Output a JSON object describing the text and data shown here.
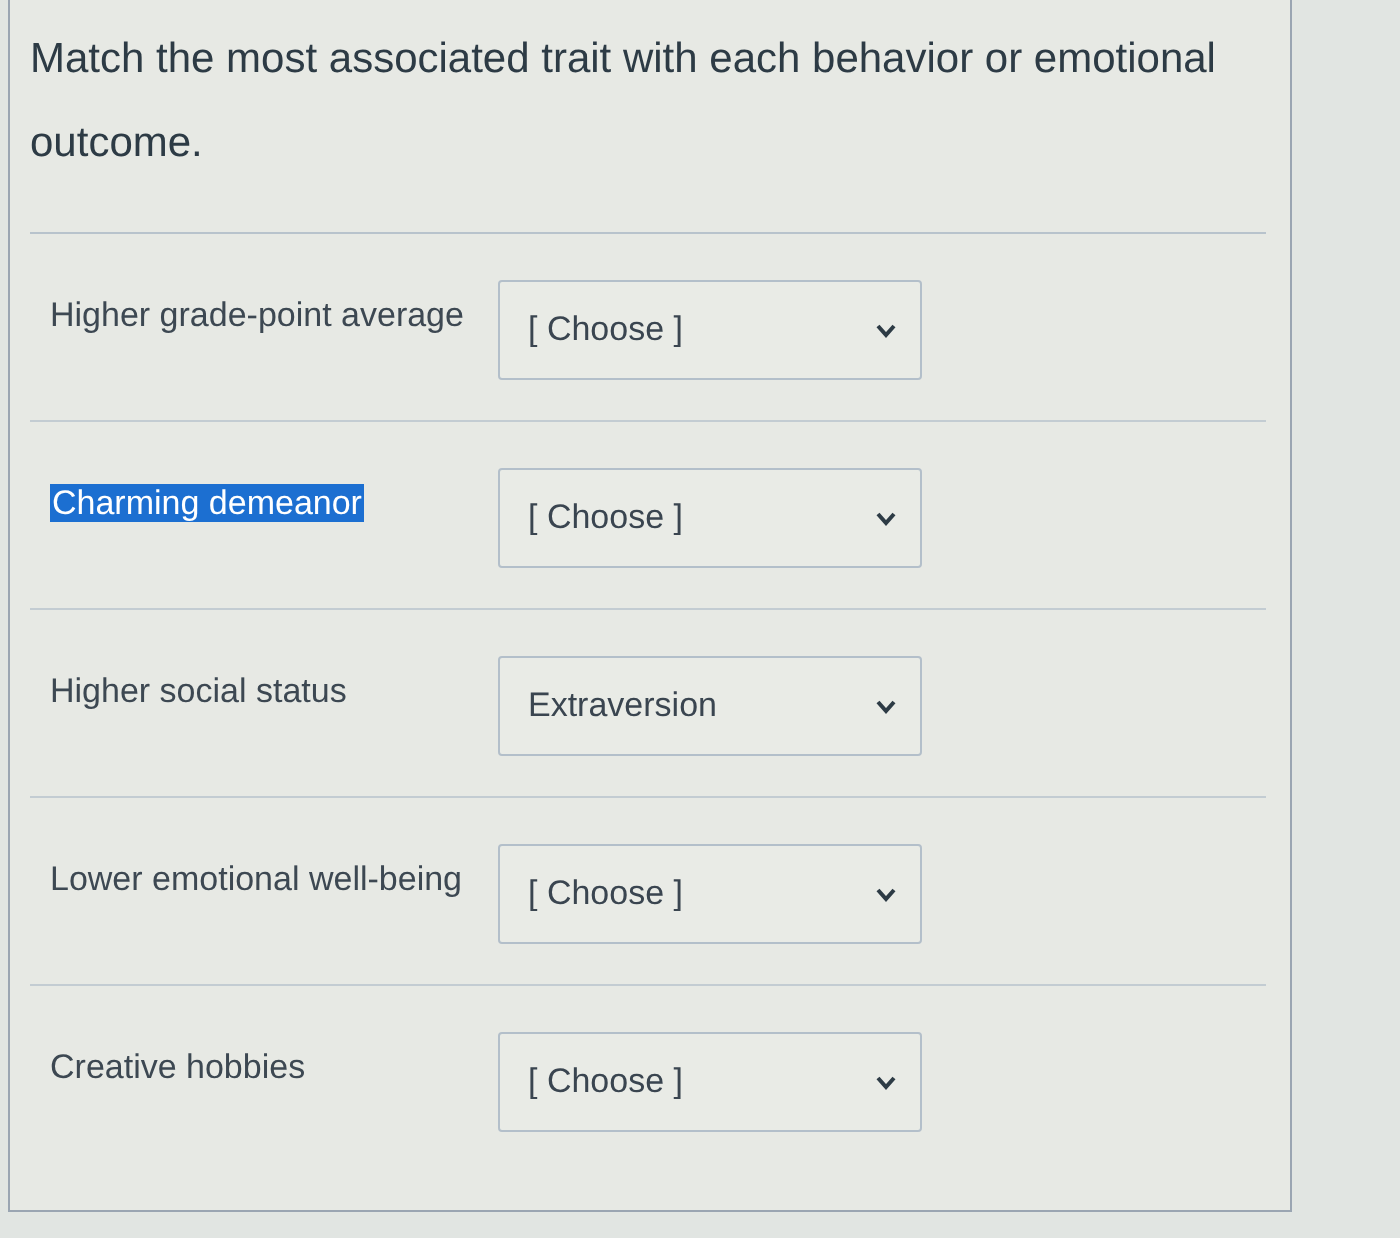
{
  "question": {
    "text": "Match the most associated trait with each behavior or emotional outcome."
  },
  "matches": [
    {
      "label": "Higher grade-point average",
      "highlighted": false,
      "answer": "[ Choose ]"
    },
    {
      "label": "Charming demeanor",
      "highlighted": true,
      "answer": "[ Choose ]"
    },
    {
      "label": "Higher social status",
      "highlighted": false,
      "answer": "Extraversion"
    },
    {
      "label": "Lower emotional well-being",
      "highlighted": false,
      "answer": "[ Choose ]"
    },
    {
      "label": "Creative hobbies",
      "highlighted": false,
      "answer": "[ Choose ]"
    }
  ]
}
